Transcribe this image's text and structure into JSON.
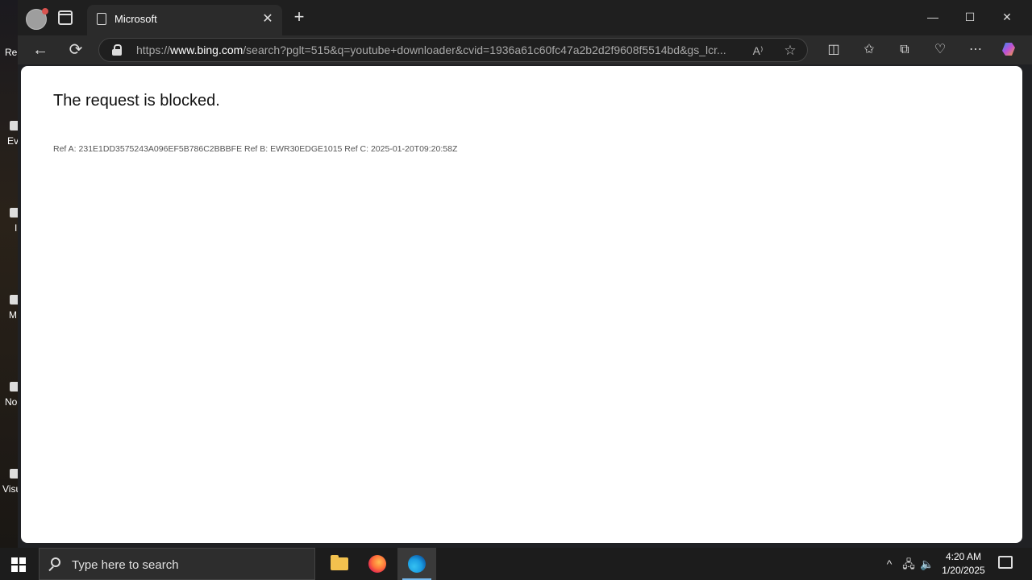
{
  "desktop": {
    "icons": [
      {
        "label": "Re"
      },
      {
        "label": "Ev"
      },
      {
        "label": "I"
      },
      {
        "label": "M"
      },
      {
        "label": "No"
      },
      {
        "label": "Visu"
      }
    ]
  },
  "browser": {
    "tab": {
      "title": "Microsoft",
      "close_glyph": "✕",
      "icon": "page-icon"
    },
    "new_tab_glyph": "+",
    "window_controls": {
      "minimize": "—",
      "maximize": "☐",
      "close": "✕"
    },
    "toolbar": {
      "back_glyph": "←",
      "refresh_glyph": "⟳",
      "url_prefix": "https://",
      "url_host": "www.bing.com",
      "url_rest": "/search?pglt=515&q=youtube+downloader&cvid=1936a61c60fc47a2b2d2f9608f5514bd&gs_lcr...",
      "read_aloud_glyph": "A⁾",
      "favorite_glyph": "☆",
      "split_glyph": "◫",
      "favorites_glyph": "✩",
      "collections_glyph": "⧉",
      "performance_glyph": "♡",
      "more_glyph": "⋯"
    },
    "page": {
      "heading": "The request is blocked.",
      "refs": "Ref A: 231E1DD3575243A096EF5B786C2BBBFE Ref B: EWR30EDGE1015 Ref C: 2025-01-20T09:20:58Z"
    }
  },
  "taskbar": {
    "search_placeholder": "Type here to search",
    "apps": [
      "file-explorer",
      "firefox",
      "edge"
    ],
    "tray": {
      "chevron": "^",
      "network": "🖧",
      "volume": "🔈"
    },
    "time": "4:20 AM",
    "date": "1/20/2025"
  },
  "colors": {
    "accent": "#76b9ed",
    "page_bg": "#ffffff",
    "chrome_bg": "#2b2b2b"
  }
}
